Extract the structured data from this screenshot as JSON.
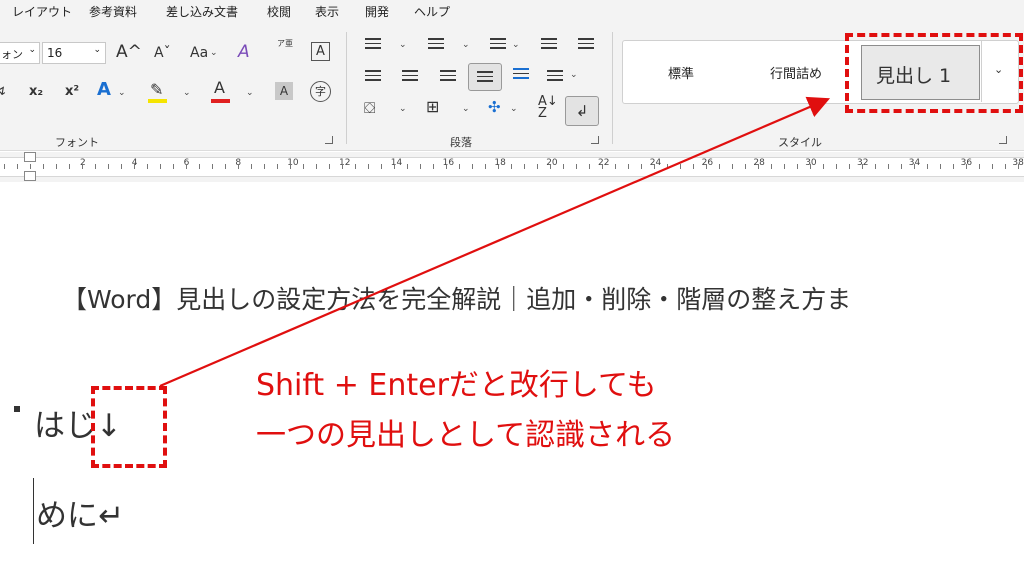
{
  "menu": {
    "tabs": [
      "レイアウト",
      "参考資料",
      "差し込み文書",
      "校閲",
      "表示",
      "開発",
      "ヘルプ"
    ]
  },
  "font_group": {
    "font_name": "ォン",
    "font_size": "16",
    "grow_font": "A^",
    "shrink_font": "Aˇ",
    "change_case": "Aa",
    "clear_format": "A",
    "phonetic": "ア亜",
    "char_border": "A",
    "subscript": "x₂",
    "superscript": "x²",
    "text_effects": "A",
    "font_color": "A",
    "char_shading": "A",
    "enclose": "字",
    "label": "フォント"
  },
  "paragraph_group": {
    "label": "段落"
  },
  "styles_group": {
    "items": [
      "標準",
      "行間詰め",
      "見出し 1"
    ],
    "label": "スタイル"
  },
  "ruler": {
    "numbers": [
      "2",
      "4",
      "6",
      "8",
      "10",
      "12",
      "14",
      "16",
      "18",
      "20",
      "22",
      "24",
      "26",
      "28",
      "30",
      "32",
      "34",
      "36",
      "38"
    ]
  },
  "document": {
    "title_line": "【Word】見出しの設定方法を完全解説｜追加・削除・階層の整え方ま",
    "heading_line1": "はじ↓",
    "heading_line2": "めに↵"
  },
  "annotation": {
    "line1": "Shift + Enterだと改行しても",
    "line2": "一つの見出しとして認識される",
    "color": "#e00f0f"
  }
}
